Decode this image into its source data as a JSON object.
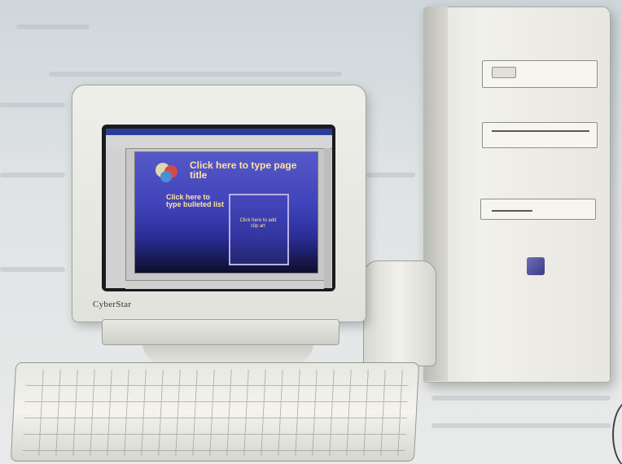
{
  "monitor": {
    "brand_label": "CyberStar"
  },
  "slide": {
    "title_text": "Click here to type page title",
    "bullet_text": "Click here to type bulleted list",
    "box_text": "Click here to add clip art"
  },
  "colors": {
    "slide_background": "#3f43b8",
    "slide_text": "#ffe3a0",
    "title_bar": "#2a3d9a"
  }
}
